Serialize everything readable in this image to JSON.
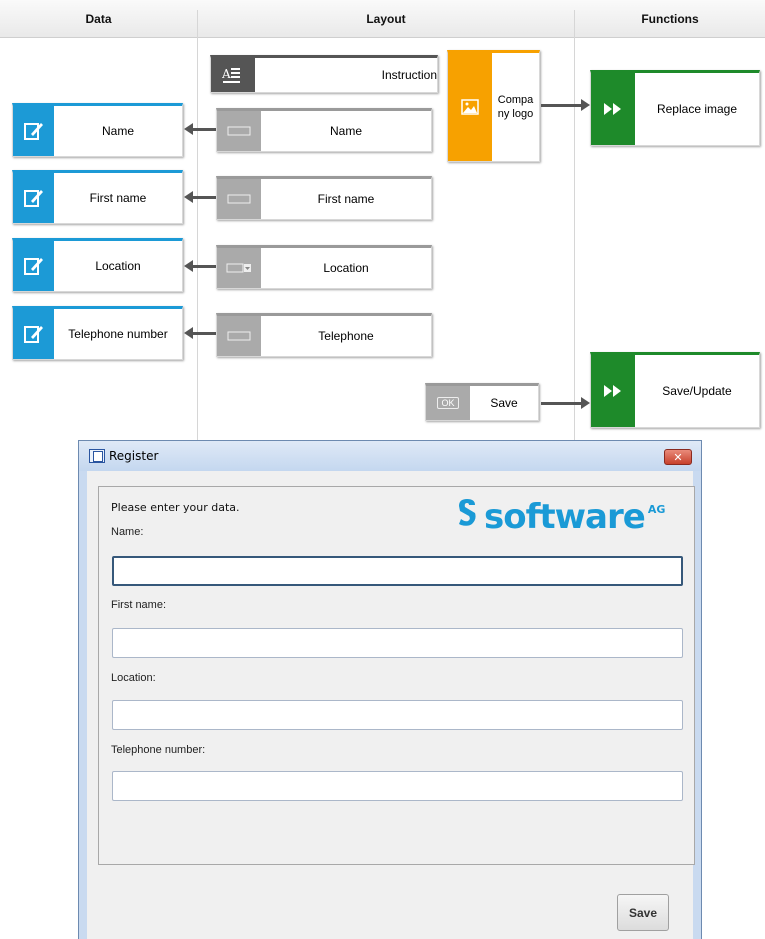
{
  "columns": {
    "data": "Data",
    "layout": "Layout",
    "functions": "Functions"
  },
  "data_objects": [
    {
      "label": "Name",
      "icon": "edit-icon"
    },
    {
      "label": "First name",
      "icon": "edit-icon"
    },
    {
      "label": "Location",
      "icon": "edit-icon"
    },
    {
      "label": "Telephone number",
      "icon": "edit-icon"
    }
  ],
  "layout_objects": {
    "instruction": "Instruction",
    "name": "Name",
    "first_name": "First name",
    "location": "Location",
    "telephone": "Telephone",
    "company_logo": "Compa ny logo",
    "save": "Save",
    "save_icon_text": "OK"
  },
  "functions": {
    "replace_image": "Replace image",
    "save_update": "Save/Update"
  },
  "dialog": {
    "title": "Register",
    "close": "✕",
    "instruction": "Please enter your data.",
    "logo_text": "software",
    "logo_sup": "AG",
    "fields": [
      {
        "label": "Name:",
        "value": ""
      },
      {
        "label": "First name:",
        "value": ""
      },
      {
        "label": "Location:",
        "value": ""
      },
      {
        "label": "Telephone number:",
        "value": ""
      }
    ],
    "save_button": "Save"
  },
  "colors": {
    "data_blue": "#1c9ad6",
    "layout_gray": "#aaaaaa",
    "function_green": "#1e8a2a",
    "image_orange": "#f7a100"
  }
}
